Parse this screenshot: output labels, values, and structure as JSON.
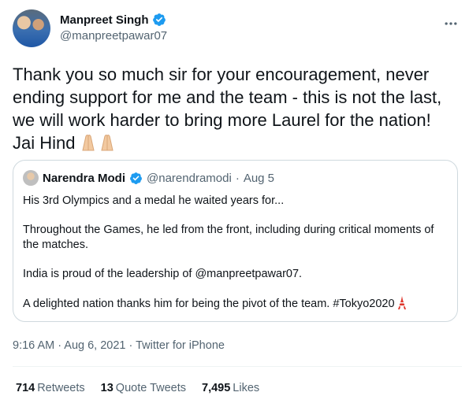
{
  "author": {
    "name": "Manpreet Singh",
    "handle": "@manpreetpawar07",
    "verified": true
  },
  "tweet_text": "Thank you so much sir for your encouragement, never ending support for me and the team - this is not the last, we will work harder to bring more Laurel for the nation! Jai Hind",
  "tweet_emoji": "folded-hands-icon x2",
  "quoted_tweet": {
    "name": "Narendra Modi",
    "handle": "@narendramodi",
    "separator": "·",
    "date": "Aug 5",
    "paragraphs": [
      "His 3rd Olympics and a medal he waited years for...",
      "Throughout the Games, he led from the front, including during critical moments of the matches.",
      "India is proud of the leadership of @manpreetpawar07.",
      "A delighted nation thanks him for being the pivot of the team. #Tokyo2020"
    ]
  },
  "timestamp": "9:16 AM · Aug 6, 2021 · Twitter for iPhone",
  "stats": {
    "retweets_count": "714",
    "retweets_label": "Retweets",
    "quotes_count": "13",
    "quotes_label": "Quote Tweets",
    "likes_count": "7,495",
    "likes_label": "Likes"
  },
  "colors": {
    "verified_blue": "#1d9bf0",
    "secondary_text": "#536471",
    "border": "#cfd9de"
  }
}
